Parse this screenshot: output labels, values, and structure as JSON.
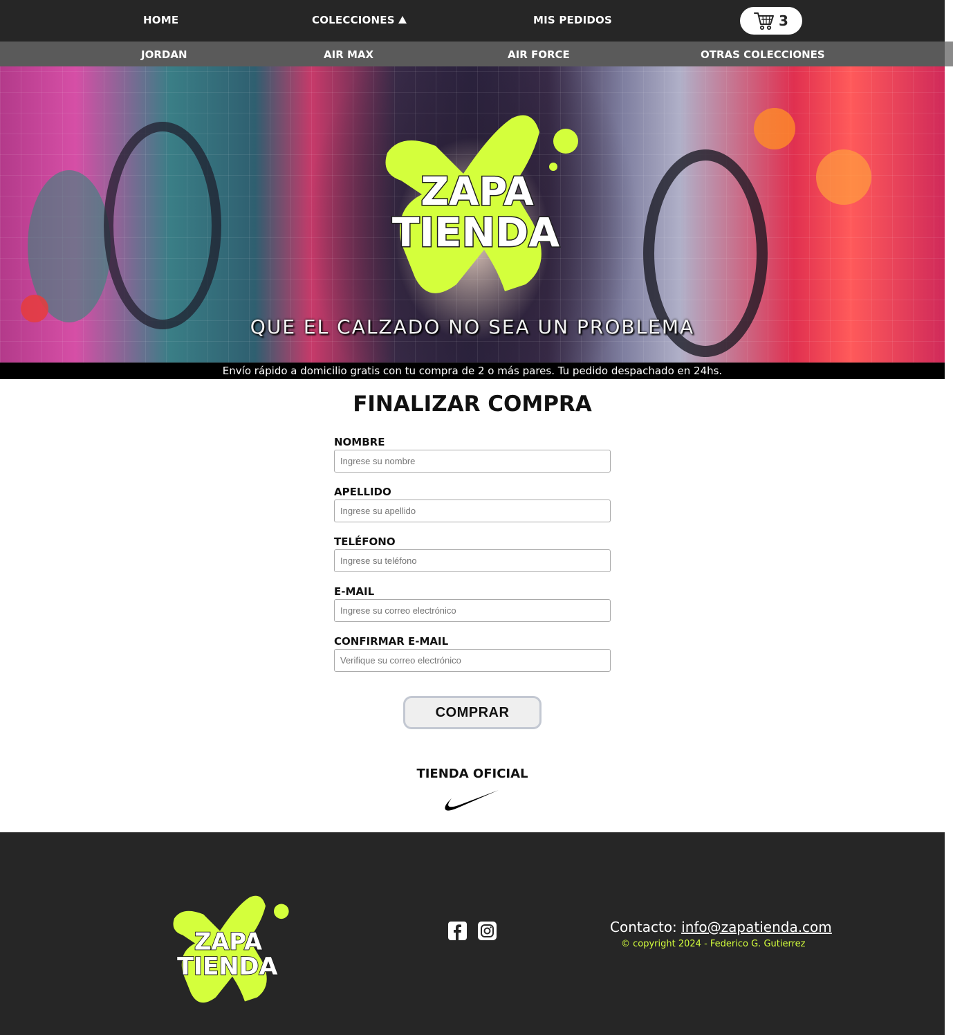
{
  "nav": {
    "home": "HOME",
    "collections": "COLECCIONES",
    "orders": "MIS PEDIDOS",
    "cart_count": "3"
  },
  "subnav": {
    "items": [
      "JORDAN",
      "AIR MAX",
      "AIR FORCE",
      "OTRAS COLECCIONES"
    ]
  },
  "hero": {
    "logo_text": "ZAPA TIENDA",
    "tagline": "QUE EL CALZADO NO SEA UN PROBLEMA"
  },
  "shipping_banner": "Envío rápido a domicilio gratis con tu compra de 2 o más pares. Tu pedido despachado en 24hs.",
  "checkout": {
    "title": "FINALIZAR COMPRA",
    "fields": [
      {
        "label": "NOMBRE",
        "placeholder": "Ingrese su nombre",
        "value": ""
      },
      {
        "label": "APELLIDO",
        "placeholder": "Ingrese su apellido",
        "value": ""
      },
      {
        "label": "TELÉFONO",
        "placeholder": "Ingrese su teléfono",
        "value": ""
      },
      {
        "label": "E-MAIL",
        "placeholder": "Ingrese su correo electrónico",
        "value": ""
      },
      {
        "label": "CONFIRMAR E-MAIL",
        "placeholder": "Verifique su correo electrónico",
        "value": ""
      }
    ],
    "submit_label": "COMPRAR"
  },
  "brand": {
    "official_label": "TIENDA OFICIAL",
    "brand_icon": "nike-swoosh-icon"
  },
  "footer": {
    "logo_text": "ZAPA TIENDA",
    "social_icons": [
      "facebook-icon",
      "instagram-icon"
    ],
    "contact_label": "Contacto:",
    "contact_email": "info@zapatienda.com",
    "copyright": "© copyright 2024 - Federico G. Gutierrez"
  },
  "colors": {
    "nav_bg": "#262626",
    "subnav_bg": "#5a5a5a",
    "accent_lime": "#d4ff3c",
    "footer_bg": "#262626"
  }
}
